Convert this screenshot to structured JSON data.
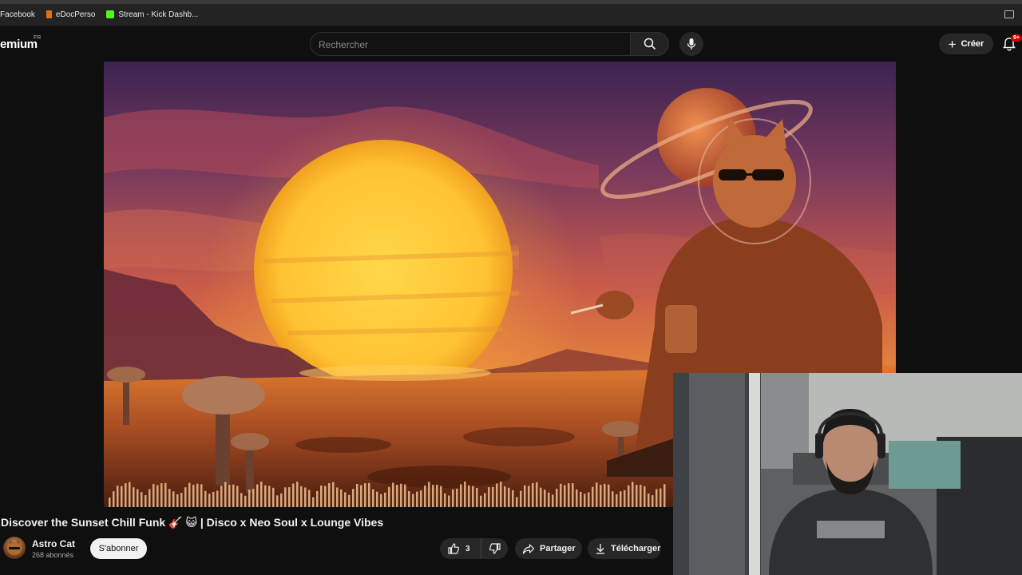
{
  "bookmarks": [
    {
      "label": "Facebook",
      "icon": "facebook-icon",
      "color": "#1877f2"
    },
    {
      "label": "eDocPerso",
      "icon": "edocperso-icon",
      "color": "#e0701a"
    },
    {
      "label": "Stream - Kick Dashb...",
      "icon": "kick-icon",
      "color": "#53fc18"
    }
  ],
  "header": {
    "logo_text": "emium",
    "logo_region": "FR",
    "search_placeholder": "Rechercher",
    "create_label": "Créer",
    "notification_badge": "9+"
  },
  "video": {
    "title": "Discover the Sunset Chill Funk 🎸 😺 | Disco x Neo Soul x Lounge Vibes",
    "channel_name": "Astro Cat",
    "subscribers": "268 abonnés",
    "subscribe_label": "S'abonner",
    "like_count": "3",
    "share_label": "Partager",
    "download_label": "Télécharger"
  },
  "colors": {
    "accent_red": "#cc0000",
    "background": "#0f0f0f",
    "pill_bg": "#272727"
  }
}
